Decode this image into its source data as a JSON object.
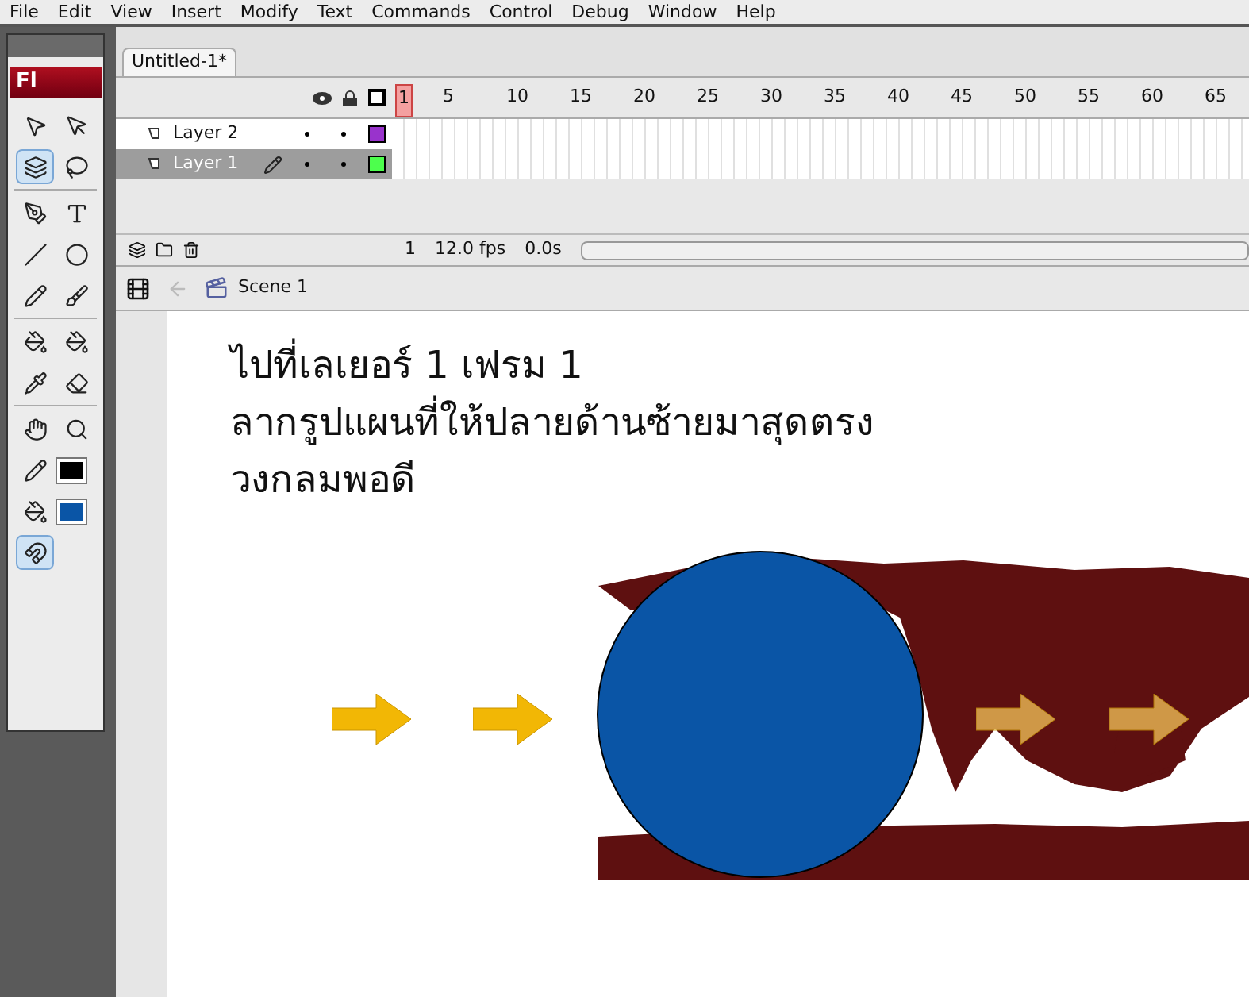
{
  "menu": [
    "File",
    "Edit",
    "View",
    "Insert",
    "Modify",
    "Text",
    "Commands",
    "Control",
    "Debug",
    "Window",
    "Help"
  ],
  "toolbox": {
    "logo": "Fl"
  },
  "document_tab": {
    "label": "Untitled-1*",
    "selected": true
  },
  "timeline": {
    "frame_numbers": [
      "1",
      "5",
      "10",
      "15",
      "20",
      "25",
      "30",
      "35",
      "40",
      "45",
      "50",
      "55",
      "60",
      "65"
    ],
    "layers": [
      {
        "name": "Layer 2",
        "selected": false,
        "color": "#9933cc"
      },
      {
        "name": "Layer 1",
        "selected": true,
        "color": "#4dff4d"
      }
    ],
    "status": {
      "frame": "1",
      "fps": "12.0 fps",
      "time": "0.0s"
    }
  },
  "scene": {
    "label": "Scene 1"
  },
  "stage": {
    "text_lines": [
      "ไปที่เลเยอร์ 1 เฟรม 1",
      "ลากรูปแผนที่ให้ปลายด้านซ้ายมาสุดตรง",
      "วงกลมพอดี"
    ]
  }
}
